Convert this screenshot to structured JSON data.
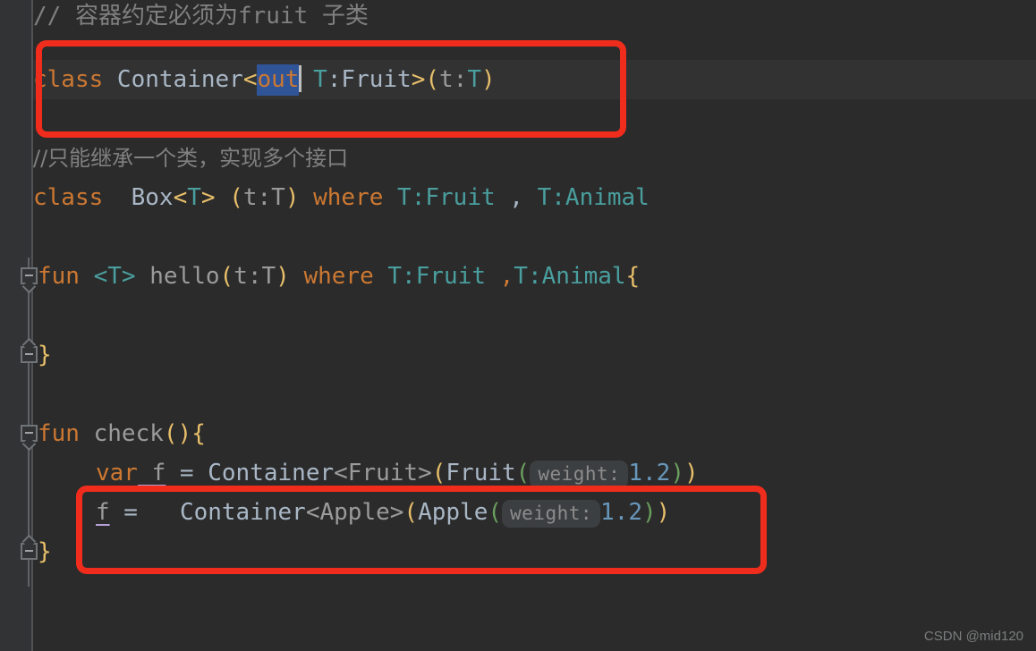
{
  "editor": {
    "theme": "darcula",
    "background": "#2b2b2b",
    "gutter_background": "#313335",
    "accent_annotation_color": "#f02d1c",
    "selection_color": "#2f5497",
    "current_line_color": "#323232"
  },
  "lines": {
    "comment_1": "// 容器约定必须为fruit 子类",
    "class_container": {
      "kw_class": "class",
      "name": " Container",
      "angle_open": "<",
      "selected_out": "out",
      "space": " ",
      "type_t": "T",
      "colon": ":",
      "type_fruit": "Fruit",
      "angle_close": ">",
      "paren_open": "(",
      "param_t": "t",
      "param_colon": ":",
      "param_type": "T",
      "paren_close": ")"
    },
    "comment_2": "//只能继承一个类，实现多个接口",
    "class_box": {
      "kw_class": "class",
      "name": "  Box",
      "angle_open": "<",
      "type_t": "T",
      "angle_close": "> ",
      "paren_open": "(",
      "param": "t:T",
      "paren_close": ") ",
      "kw_where": "where",
      "constraint_1": " T:Fruit ",
      "comma": ",",
      "constraint_2": " T:Animal"
    },
    "fun_hello": {
      "kw_fun": "fun",
      "generic": " <T> ",
      "name": "hello",
      "paren_open": "(",
      "param": "t:T",
      "paren_close": ") ",
      "kw_where": "where",
      "constraint_1": " T:Fruit ",
      "comma": ",",
      "constraint_2": "T:Animal",
      "brace": "{"
    },
    "close_brace_1": "}",
    "fun_check": {
      "kw_fun": "fun",
      "name": " check",
      "paren_open": "(",
      "paren_close": ")",
      "brace": "{"
    },
    "var_f": {
      "kw_var": "var",
      "name": " f",
      "equals": " = ",
      "ctor": "Container",
      "angle_open": "<",
      "type_arg": "Fruit",
      "angle_close": ">",
      "paren_open": "(",
      "arg_ctor": "Fruit",
      "arg_paren_open": "(",
      "hint": "weight:",
      "value": "1.2",
      "arg_paren_close": ")",
      "paren_close": ")"
    },
    "assign_f": {
      "name": "f",
      "equals": " =   ",
      "ctor": "Container",
      "angle_open": "<",
      "type_arg": "Apple",
      "angle_close": ">",
      "paren_open": "(",
      "arg_ctor": "Apple",
      "arg_paren_open": "(",
      "hint": "weight:",
      "value": "1.2",
      "arg_paren_close": ")",
      "paren_close": ")"
    },
    "close_brace_2": "}"
  },
  "annotations": {
    "box_1_label": "highlight-class-container-out",
    "box_2_label": "highlight-assign-f-container-apple"
  },
  "watermark": {
    "text": "CSDN @mid120"
  }
}
